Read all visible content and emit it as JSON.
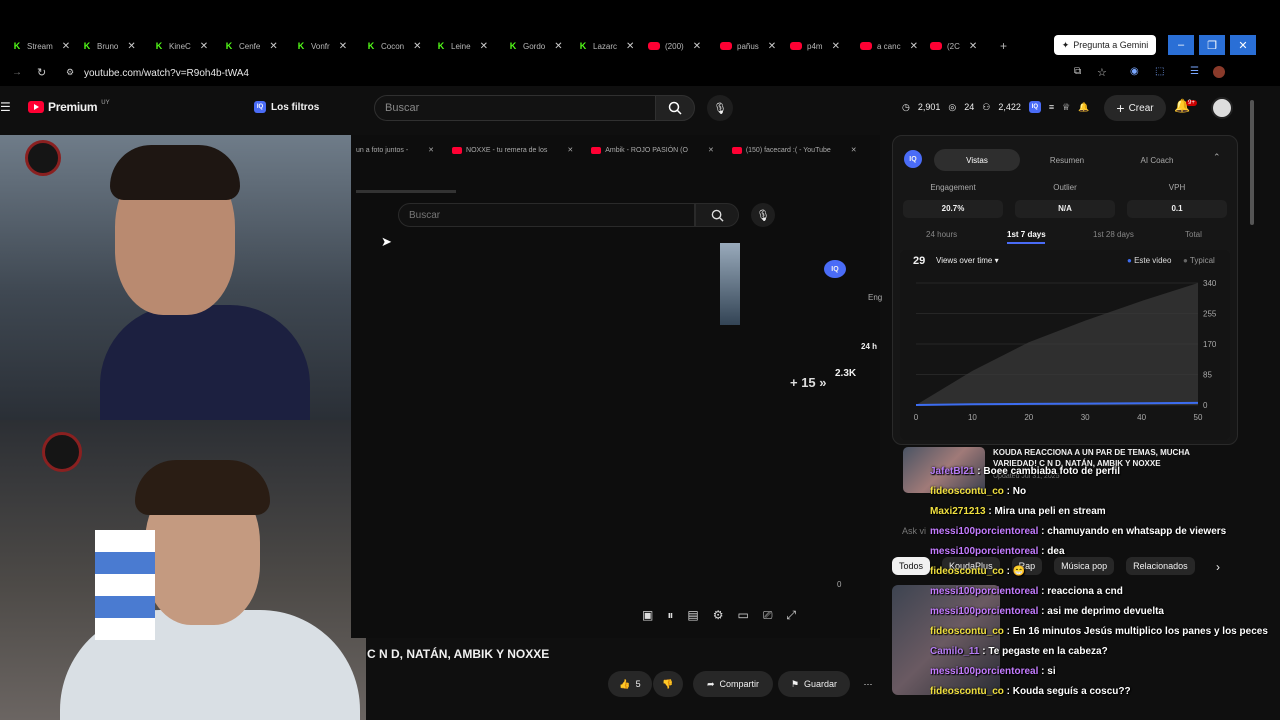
{
  "browser": {
    "tabs": [
      {
        "label": "Stream",
        "icon": "kick-icon"
      },
      {
        "label": "Bruno",
        "icon": "kick-icon"
      },
      {
        "label": "KineC",
        "icon": "kick-icon"
      },
      {
        "label": "Cenfe",
        "icon": "kick-icon"
      },
      {
        "label": "Vonfr",
        "icon": "kick-icon"
      },
      {
        "label": "Cocon",
        "icon": "kick-icon"
      },
      {
        "label": "Leine",
        "icon": "kick-icon"
      },
      {
        "label": "Gordo",
        "icon": "kick-icon"
      },
      {
        "label": "Lazarc",
        "icon": "kick-icon"
      },
      {
        "label": "(200)",
        "icon": "youtube-icon"
      },
      {
        "label": "pañus",
        "icon": "youtube-icon"
      },
      {
        "label": "p4m",
        "icon": "youtube-icon"
      },
      {
        "label": "a canc",
        "icon": "youtube-icon"
      },
      {
        "label": "(2C",
        "icon": "youtube-icon"
      }
    ],
    "gemini_label": "Pregunta a Gemini",
    "url": "youtube.com/watch?v=R9oh4b-tWA4"
  },
  "youtube": {
    "logo_text": "Premium",
    "logo_region": "UY",
    "filters_label": "Los filtros",
    "search_placeholder": "Buscar",
    "stats": {
      "views": "2,901",
      "eye": "24",
      "subs": "2,422"
    },
    "create_label": "Crear",
    "notif_count": "9+"
  },
  "inner": {
    "tabs": [
      {
        "label": "un a foto juntos -"
      },
      {
        "label": "NOXXE - tu remera de los"
      },
      {
        "label": "Ambik - ROJO PASIÓN (O"
      },
      {
        "label": "(150) facecard :( - YouTube"
      }
    ],
    "search_placeholder": "Buscar",
    "skip_label": "+ 15",
    "overlay_views": "2.3K",
    "overlay_24h": "24 h",
    "overlay_eng": "Eng"
  },
  "video": {
    "title": "C N D, NATÁN, AMBIK Y NOXXE",
    "likes": "5",
    "share_label": "Compartir",
    "save_label": "Guardar"
  },
  "panel": {
    "tabs": [
      "Vistas",
      "Resumen",
      "AI Coach"
    ],
    "metrics": [
      {
        "label": "Engagement",
        "value": "20.7%"
      },
      {
        "label": "Outlier",
        "value": "N/A"
      },
      {
        "label": "VPH",
        "value": "0.1"
      }
    ],
    "ranges": [
      "24 hours",
      "1st 7 days",
      "1st 28 days",
      "Total"
    ],
    "count": "29",
    "dropdown_label": "Views over time",
    "legend": [
      "Este video",
      "Typical"
    ]
  },
  "chart_data": {
    "type": "area",
    "x": [
      0,
      10,
      20,
      30,
      40,
      50
    ],
    "xticks": [
      "0",
      "10",
      "20",
      "30",
      "40",
      "50"
    ],
    "yticks": [
      "0",
      "85",
      "170",
      "255",
      "340"
    ],
    "ylim": [
      0,
      340
    ],
    "series": [
      {
        "name": "Este video",
        "values": [
          0,
          2,
          3,
          4,
          5,
          6
        ]
      },
      {
        "name": "Typical",
        "values": [
          0,
          95,
          175,
          235,
          290,
          340
        ]
      }
    ]
  },
  "suggestion": {
    "title": "KOUDA REACCIONA A UN PAR DE TEMAS, MUCHA VARIEDAD! C N D, NATÁN, AMBIK Y NOXXE",
    "meta": "Updated Jul 31, 2025"
  },
  "ask_label": "Ask vi",
  "chips": [
    "Todos",
    "KoudaPlus",
    "Rap",
    "Música pop",
    "Relacionados"
  ],
  "chat": [
    {
      "user": "JafetBl21",
      "msg": "Boee cambiaba foto de perfil",
      "cls": "u2"
    },
    {
      "user": "fideoscontu_co",
      "msg": "No",
      "cls": "u4"
    },
    {
      "user": "Maxi271213",
      "msg": "Mira una peli en stream",
      "cls": "u4"
    },
    {
      "user": "messi100porcientoreal",
      "msg": "chamuyando en whatsapp de viewers",
      "cls": "u3"
    },
    {
      "user": "messi100porcientoreal",
      "msg": "dea",
      "cls": "u3"
    },
    {
      "user": "fideoscontu_co",
      "msg": "😁",
      "cls": "u4"
    },
    {
      "user": "messi100porcientoreal",
      "msg": "reacciona a cnd",
      "cls": "u3"
    },
    {
      "user": "messi100porcientoreal",
      "msg": "asi me deprimo devuelta",
      "cls": "u3"
    },
    {
      "user": "fideoscontu_co",
      "msg": "En 16 minutos Jesús multiplico los panes y los peces",
      "cls": "u4"
    },
    {
      "user": "Camilo_11",
      "msg": "Te pegaste en la cabeza?",
      "cls": "u2"
    },
    {
      "user": "messi100porcientoreal",
      "msg": "si",
      "cls": "u3"
    },
    {
      "user": "fideoscontu_co",
      "msg": "Kouda seguís a coscu??",
      "cls": "u4"
    }
  ]
}
